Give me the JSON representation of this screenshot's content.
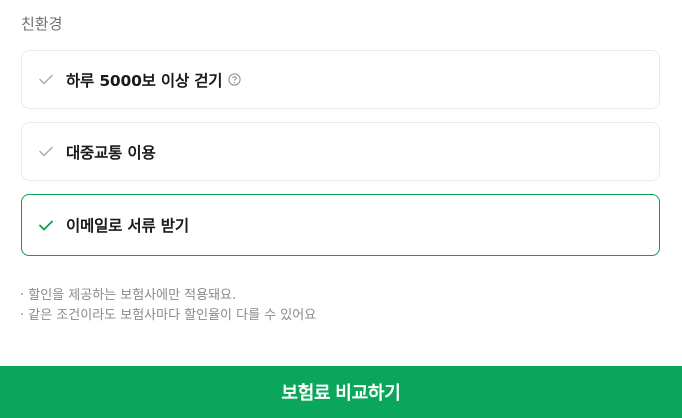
{
  "section": {
    "title": "친환경"
  },
  "options": [
    {
      "label": "하루 5000보 이상 걷기",
      "selected": false,
      "has_help": true,
      "check_color": "#b5b5b5"
    },
    {
      "label": "대중교통 이용",
      "selected": false,
      "has_help": false,
      "check_color": "#b5b5b5"
    },
    {
      "label": "이메일로 서류 받기",
      "selected": true,
      "has_help": false,
      "check_color": "#0aa050"
    }
  ],
  "notes": [
    "· 할인을 제공하는 보험사에만 적용돼요.",
    "· 같은 조건이라도 보험사마다 할인율이 다를 수 있어요"
  ],
  "cta": {
    "label": "보험료 비교하기"
  },
  "colors": {
    "accent": "#0aa65a",
    "selected_border": "#0aa050",
    "muted_text": "#8a8a8a"
  },
  "icons": {
    "check": "check-icon",
    "help": "question-circle-icon"
  }
}
